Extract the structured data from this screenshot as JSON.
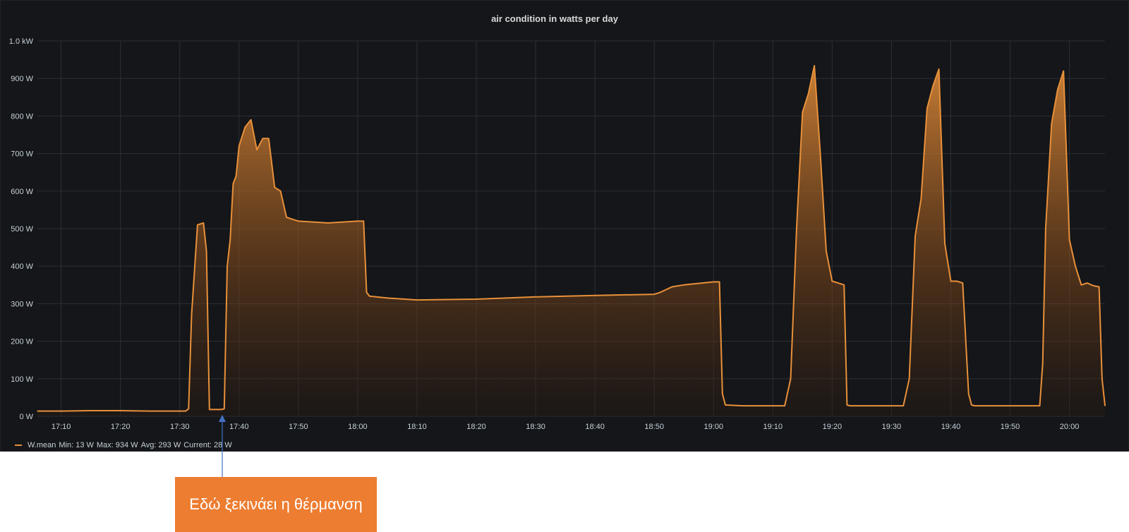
{
  "chart_data": {
    "type": "area",
    "title": "air condition in watts per day",
    "xlabel": "",
    "ylabel": "",
    "x_ticks": [
      "17:10",
      "17:20",
      "17:30",
      "17:40",
      "17:50",
      "18:00",
      "18:10",
      "18:20",
      "18:30",
      "18:40",
      "18:50",
      "19:00",
      "19:10",
      "19:20",
      "19:30",
      "19:40",
      "19:50",
      "20:00"
    ],
    "y_ticks": [
      "0 W",
      "100 W",
      "200 W",
      "300 W",
      "400 W",
      "500 W",
      "600 W",
      "700 W",
      "800 W",
      "900 W",
      "1.0 kW"
    ],
    "ylim": [
      0,
      1000
    ],
    "xlim": [
      "17:06",
      "20:06"
    ],
    "grid": true,
    "legend_position": "bottom-left",
    "series": [
      {
        "name": "W.mean",
        "color": "#e8903a",
        "x": [
          "17:06",
          "17:10",
          "17:15",
          "17:20",
          "17:25",
          "17:30",
          "17:31",
          "17:31:30",
          "17:32",
          "17:33",
          "17:34",
          "17:34:30",
          "17:35",
          "17:37",
          "17:37:30",
          "17:38",
          "17:38:30",
          "17:39",
          "17:39:30",
          "17:40",
          "17:41",
          "17:42",
          "17:43",
          "17:44",
          "17:45",
          "17:46",
          "17:47",
          "17:48",
          "17:49",
          "17:50",
          "17:55",
          "18:00",
          "18:01",
          "18:01:30",
          "18:02",
          "18:05",
          "18:10",
          "18:20",
          "18:30",
          "18:40",
          "18:50",
          "18:51",
          "18:53",
          "18:55",
          "19:00",
          "19:01",
          "19:01:30",
          "19:02",
          "19:05",
          "19:10",
          "19:12",
          "19:13",
          "19:14",
          "19:15",
          "19:16",
          "19:17",
          "19:18",
          "19:19",
          "19:20",
          "19:21",
          "19:22",
          "19:22:30",
          "19:23",
          "19:30",
          "19:32",
          "19:33",
          "19:34",
          "19:35",
          "19:36",
          "19:37",
          "19:38",
          "19:39",
          "19:40",
          "19:41",
          "19:42",
          "19:43",
          "19:43:30",
          "19:44",
          "19:50",
          "19:54",
          "19:55",
          "19:55:30",
          "19:56",
          "19:57",
          "19:58",
          "19:59",
          "20:00",
          "20:01",
          "20:02",
          "20:03",
          "20:04",
          "20:05",
          "20:05:30",
          "20:06"
        ],
        "values": [
          14,
          14,
          15,
          15,
          14,
          14,
          14,
          20,
          270,
          510,
          515,
          440,
          18,
          18,
          20,
          400,
          470,
          620,
          640,
          720,
          770,
          790,
          710,
          740,
          740,
          610,
          600,
          530,
          525,
          520,
          515,
          520,
          520,
          330,
          320,
          315,
          310,
          312,
          318,
          322,
          325,
          330,
          345,
          350,
          358,
          358,
          60,
          30,
          28,
          28,
          28,
          100,
          500,
          810,
          860,
          934,
          700,
          440,
          360,
          355,
          350,
          30,
          28,
          28,
          28,
          100,
          480,
          580,
          820,
          880,
          925,
          460,
          360,
          360,
          355,
          60,
          30,
          28,
          28,
          28,
          28,
          140,
          500,
          780,
          870,
          920,
          470,
          400,
          350,
          355,
          348,
          345,
          100,
          28
        ]
      }
    ],
    "legend_text": {
      "name": "W.mean",
      "min": "Min: 13 W",
      "max": "Max: 934 W",
      "avg": "Avg: 293 W",
      "current": "Current: 28 W"
    }
  },
  "annotation": {
    "text": "Εδώ ξεκινάει η θέρμανση",
    "box_color": "#ed7d31",
    "arrow_color": "#4472c4",
    "target_time": "17:37"
  },
  "colors": {
    "panel_background": "#141619",
    "grid": "#2c2f35",
    "axis_text": "#c7d0d9",
    "series": "#e8903a"
  }
}
